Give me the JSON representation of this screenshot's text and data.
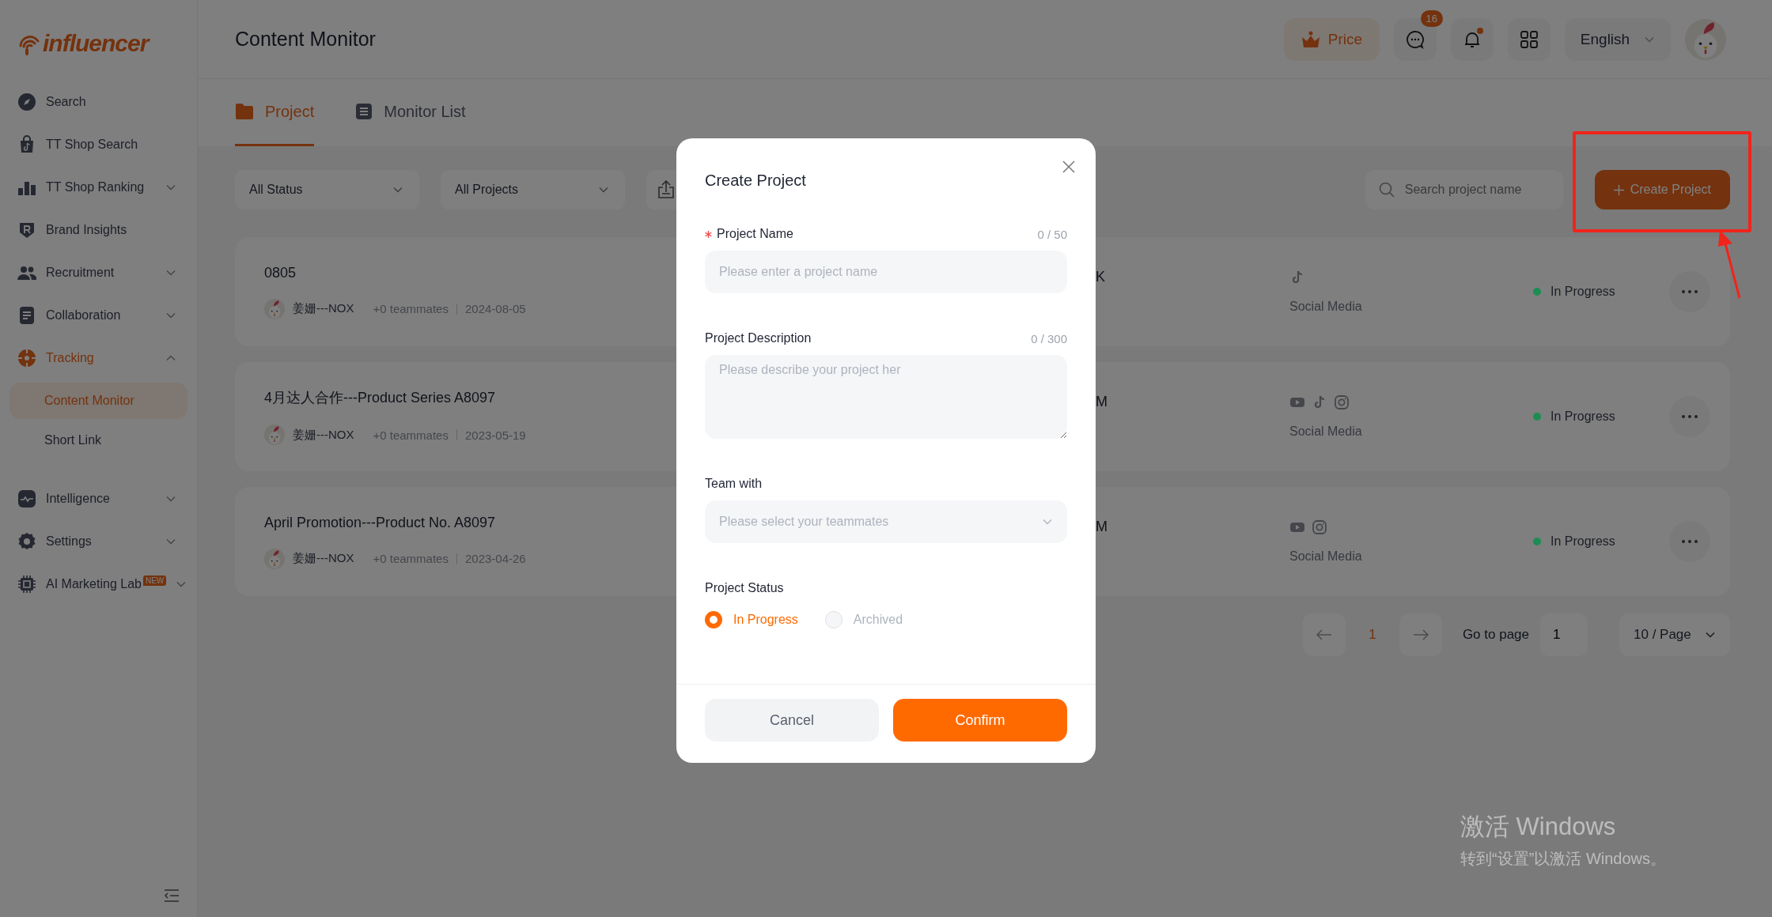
{
  "sidebar": {
    "logo": "influencer",
    "items": [
      {
        "label": "Search",
        "kind": "link",
        "selected": false
      },
      {
        "label": "TT Shop Search",
        "kind": "link",
        "selected": false
      },
      {
        "label": "TT Shop Ranking",
        "kind": "group",
        "expanded": false,
        "selected": false
      },
      {
        "label": "Brand Insights",
        "kind": "link",
        "selected": false
      },
      {
        "label": "Recruitment",
        "kind": "group",
        "expanded": false,
        "selected": false
      },
      {
        "label": "Collaboration",
        "kind": "group",
        "expanded": false,
        "selected": false
      },
      {
        "label": "Tracking",
        "kind": "group",
        "expanded": true,
        "selected": true,
        "children": [
          {
            "label": "Content Monitor",
            "selected": true
          },
          {
            "label": "Short Link",
            "selected": false
          }
        ]
      },
      {
        "label": "Intelligence",
        "kind": "group",
        "expanded": false,
        "selected": false
      },
      {
        "label": "Settings",
        "kind": "group",
        "expanded": false,
        "selected": false
      },
      {
        "label": "AI Marketing Lab",
        "kind": "group",
        "expanded": false,
        "selected": false,
        "badge": "NEW"
      }
    ]
  },
  "header": {
    "title": "Content Monitor",
    "price_button": "Price",
    "messages_badge": "16",
    "notifications_unread": true,
    "language": "English"
  },
  "tabs": [
    {
      "label": "Project",
      "selected": true
    },
    {
      "label": "Monitor List",
      "selected": false
    }
  ],
  "filters": {
    "status": "All Status",
    "projects": "All Projects",
    "search_placeholder": "Search project name",
    "create_button": "Create Project"
  },
  "projects": [
    {
      "title": "0805",
      "owner": "姜姗---NOX",
      "teammates": "+0 teammates",
      "date": "2024-08-05",
      "column_3": "K",
      "platforms": [
        {
          "kind": "note"
        }
      ],
      "category": "Social Media",
      "status": "In Progress",
      "color": "#1d8c53"
    },
    {
      "title": "4月达人合作---Product Series A8097",
      "owner": "姜姗---NOX",
      "teammates": "+0 teammates",
      "date": "2023-05-19",
      "column_3": "M",
      "platforms": [
        {
          "kind": "play"
        },
        {
          "kind": "note"
        },
        {
          "kind": "camera"
        }
      ],
      "category": "Social Media",
      "status": "In Progress",
      "color": "#1d8c53"
    },
    {
      "title": "April Promotion---Product No. A8097",
      "owner": "姜姗---NOX",
      "teammates": "+0 teammates",
      "date": "2023-04-26",
      "column_3": "M",
      "platforms": [
        {
          "kind": "play"
        },
        {
          "kind": "camera"
        }
      ],
      "category": "Social Media",
      "status": "In Progress",
      "color": "#1d8c53"
    }
  ],
  "pagination": {
    "pages": [
      {
        "label": "1",
        "selected": true
      }
    ],
    "go_to_label": "Go to page",
    "go_to_value": "1",
    "page_size": "10 / Page"
  },
  "dialog": {
    "title": "Create Project",
    "fields": [
      {
        "kind": "input",
        "label": "Project Name",
        "required": true,
        "counter": "0 / 50",
        "placeholder": "Please enter a project name"
      },
      {
        "kind": "textarea",
        "label": "Project Description",
        "required": false,
        "counter": "0 / 300",
        "placeholder": "Please describe your project her"
      },
      {
        "kind": "select",
        "label": "Team with",
        "required": false,
        "placeholder": "Please select your teammates"
      }
    ],
    "status_label": "Project Status",
    "status_options": [
      {
        "label": "In Progress",
        "selected": true
      },
      {
        "label": "Archived",
        "selected": false
      }
    ],
    "cancel": "Cancel",
    "confirm": "Confirm"
  },
  "os_notice": {
    "title": "激活 Windows",
    "message": "转到“设置”以激活 Windows。"
  }
}
